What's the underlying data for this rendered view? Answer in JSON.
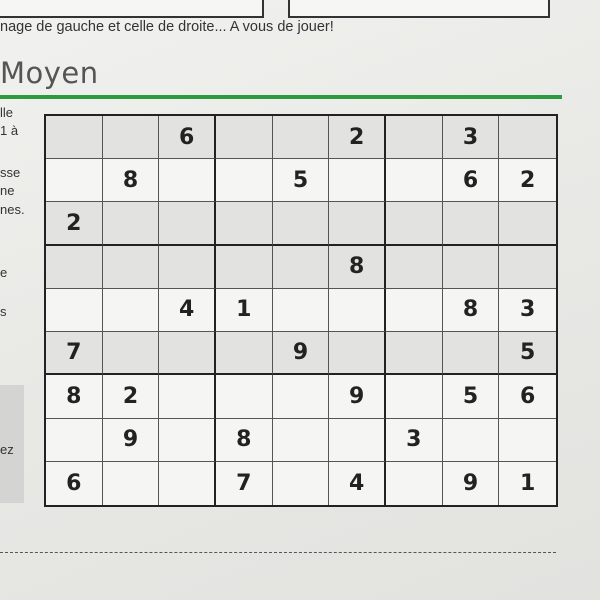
{
  "intro_text": "nage de gauche et celle de droite... A vous de jouer!",
  "heading": "Moyen",
  "side_fragments": [
    "lle",
    "1 à",
    "sse",
    "ne",
    "nes.",
    "e",
    "s",
    "ez"
  ],
  "puzzle": {
    "cells": [
      [
        "",
        "",
        "6",
        "",
        "",
        "2",
        "",
        "3",
        ""
      ],
      [
        "",
        "8",
        "",
        "",
        "5",
        "",
        "",
        "6",
        "2"
      ],
      [
        "2",
        "",
        "",
        "",
        "",
        "",
        "",
        "",
        ""
      ],
      [
        "",
        "",
        "",
        "",
        "",
        "8",
        "",
        "",
        ""
      ],
      [
        "",
        "",
        "4",
        "1",
        "",
        "",
        "",
        "8",
        "3"
      ],
      [
        "7",
        "",
        "",
        "",
        "9",
        "",
        "",
        "",
        "5"
      ],
      [
        "8",
        "2",
        "",
        "",
        "",
        "9",
        "",
        "5",
        "6"
      ],
      [
        "",
        "9",
        "",
        "8",
        "",
        "",
        "3",
        "",
        ""
      ],
      [
        "6",
        "",
        "",
        "7",
        "",
        "4",
        "",
        "9",
        "1"
      ]
    ]
  },
  "colors": {
    "accent_rule": "#2e9a3f",
    "grid_lines": "#222222",
    "shaded_band": "#e2e2e0"
  }
}
